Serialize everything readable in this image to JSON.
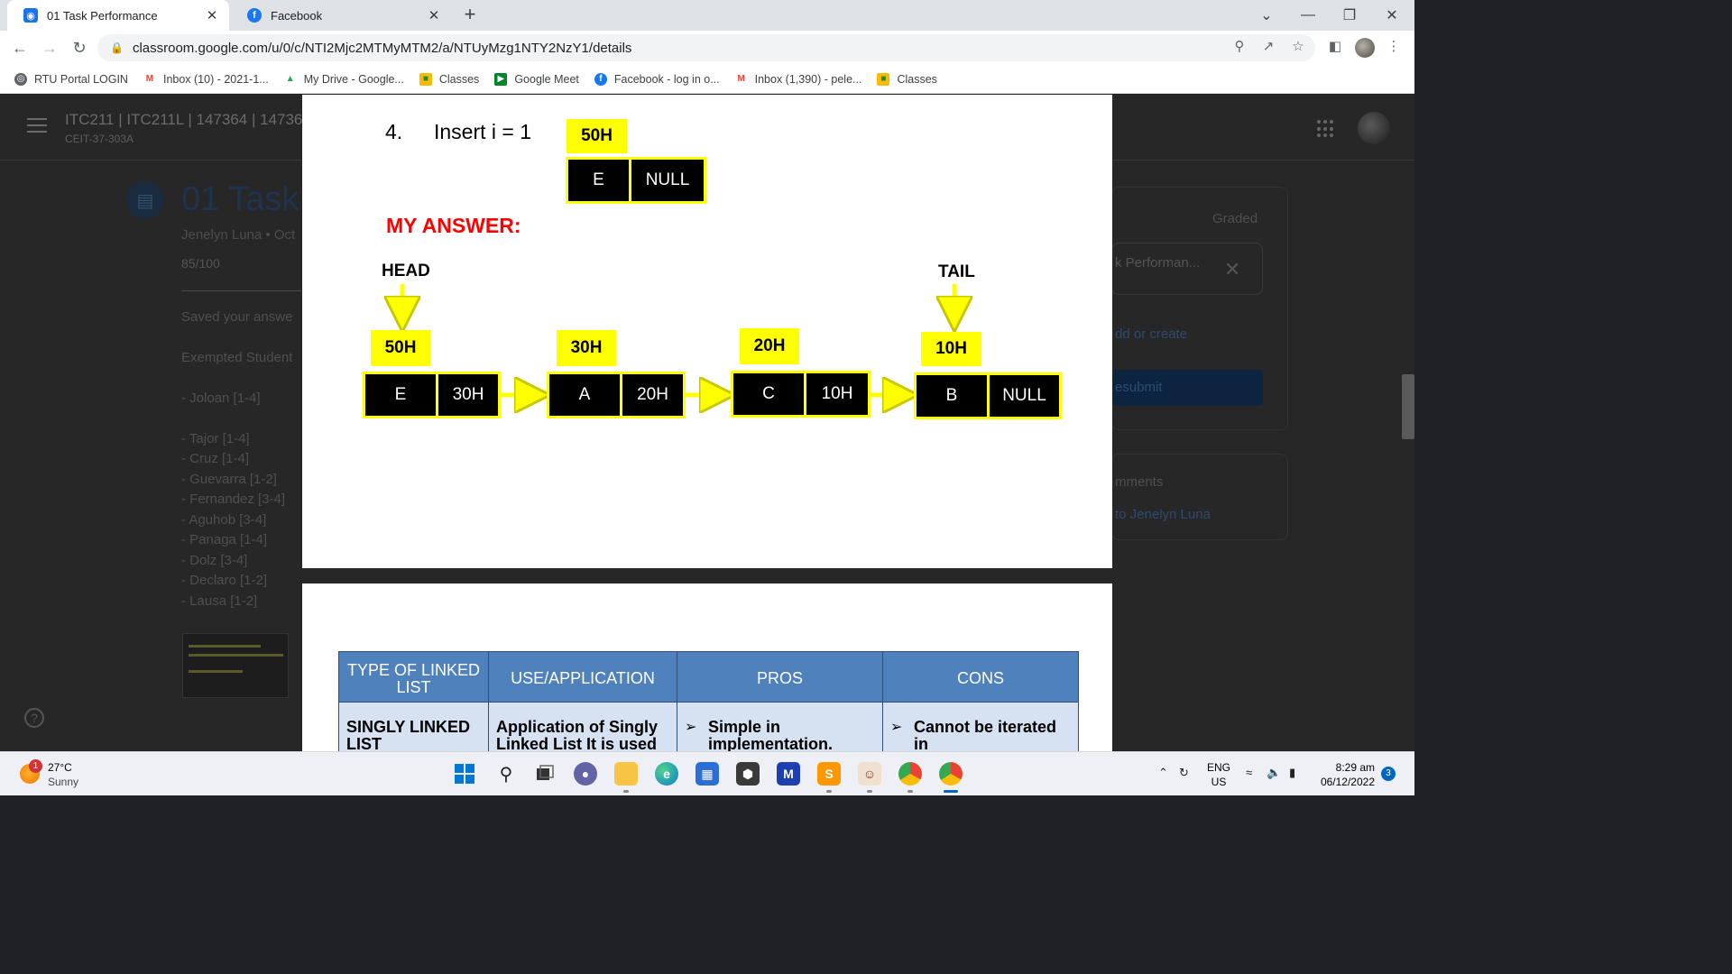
{
  "browser": {
    "tabs": [
      {
        "title": "01 Task Performance",
        "active": true
      },
      {
        "title": "Facebook",
        "active": false
      }
    ],
    "new_tab_icon": "plus-icon",
    "url": "classroom.google.com/u/0/c/NTI2Mjc2MTMyMTM2/a/NTUyMzg1NTY2NzY1/details",
    "bookmarks": [
      {
        "label": "RTU Portal LOGIN",
        "icon": "globe-icon"
      },
      {
        "label": "Inbox (10) - 2021-1...",
        "icon": "gmail-icon"
      },
      {
        "label": "My Drive - Google...",
        "icon": "drive-icon"
      },
      {
        "label": "Classes",
        "icon": "classroom-icon"
      },
      {
        "label": "Google Meet",
        "icon": "meet-icon"
      },
      {
        "label": "Facebook - log in o...",
        "icon": "facebook-icon"
      },
      {
        "label": "Inbox (1,390) - pele...",
        "icon": "gmail-icon"
      },
      {
        "label": "Classes",
        "icon": "classroom-icon"
      }
    ]
  },
  "classroom": {
    "course_title": "ITC211 | ITC211L | 147364 | 14736",
    "course_section": "CEIT-37-303A",
    "assignment_title": "01 Task P",
    "meta": "Jenelyn Luna • Oct",
    "score": "85/100",
    "saved_text": "Saved your answe",
    "exempted_label": "Exempted Student",
    "students_group1": [
      "- Joloan [1-4]"
    ],
    "students_group2": [
      "- Tajor [1-4]",
      "- Cruz [1-4]",
      "- Guevarra [1-2]",
      "- Fernandez [3-4]",
      "- Aguhob [3-4]",
      "- Panaga [1-4]",
      "- Dolz [3-4]",
      "- Declaro [1-2]",
      "- Lausa [1-2]"
    ],
    "right_panel": {
      "graded": "Graded",
      "attachment_name": "k Performan...",
      "add_or_create": "dd or create",
      "resubmit": "esubmit",
      "comments_title": "mments",
      "comments_link": "to Jenelyn Luna"
    }
  },
  "viewer": {
    "page1": {
      "question_number": "4.",
      "question_text": "Insert i = 1",
      "new_node": {
        "address": "50H",
        "data": "E",
        "next": "NULL"
      },
      "my_answer": "MY ANSWER:",
      "head_label": "HEAD",
      "tail_label": "TAIL",
      "nodes": [
        {
          "address": "50H",
          "data": "E",
          "next": "30H"
        },
        {
          "address": "30H",
          "data": "A",
          "next": "20H"
        },
        {
          "address": "20H",
          "data": "C",
          "next": "10H"
        },
        {
          "address": "10H",
          "data": "B",
          "next": "NULL"
        }
      ]
    },
    "page2": {
      "headers": [
        "TYPE OF LINKED LIST",
        "USE/APPLICATION",
        "PROS",
        "CONS"
      ],
      "row": [
        "SINGLY LINKED LIST",
        "Application of Singly Linked List It is used",
        "Simple in implementation.",
        "Cannot be iterated in"
      ]
    }
  },
  "taskbar": {
    "weather_temp": "27°C",
    "weather_condition": "Sunny",
    "weather_badge": "1",
    "language": "ENG",
    "region": "US",
    "time": "8:29 am",
    "date": "06/12/2022",
    "notification_count": "3"
  },
  "colors": {
    "node_yellow": "#ffff00",
    "answer_red": "#ff0000",
    "table_header": "#4f81bd",
    "table_cell": "#d6e1f1"
  }
}
